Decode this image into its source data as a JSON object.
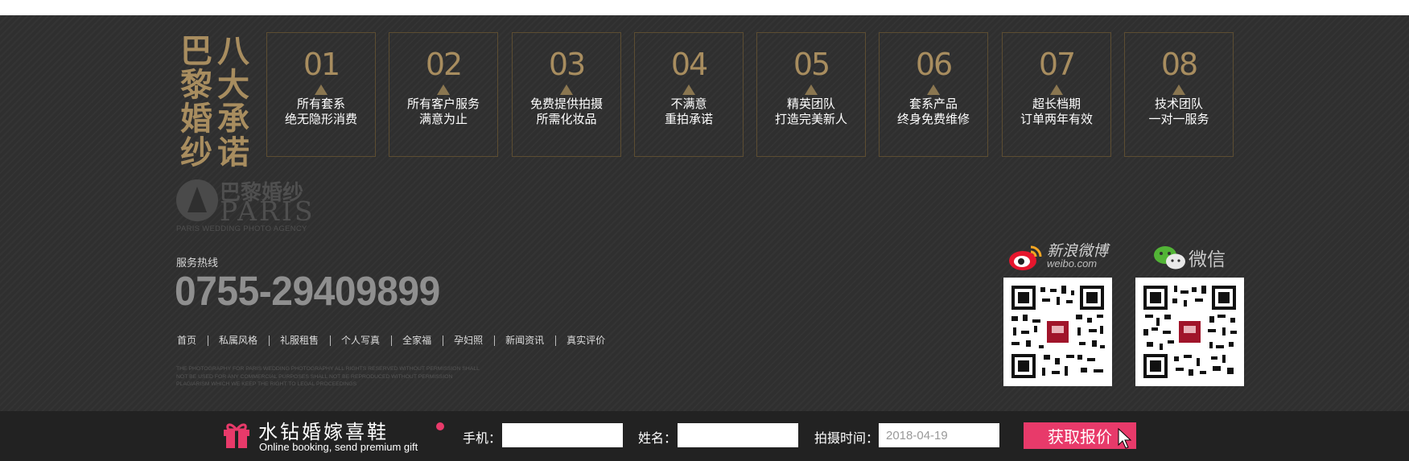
{
  "footer": {
    "title_col1": "巴黎婚纱",
    "title_col2": "八大承诺",
    "promises": [
      {
        "num": "01",
        "line1": "所有套系",
        "line2": "绝无隐形消费"
      },
      {
        "num": "02",
        "line1": "所有客户服务",
        "line2": "满意为止"
      },
      {
        "num": "03",
        "line1": "免费提供拍摄",
        "line2": "所需化妆品"
      },
      {
        "num": "04",
        "line1": "不满意",
        "line2": "重拍承诺"
      },
      {
        "num": "05",
        "line1": "精英团队",
        "line2": "打造完美新人"
      },
      {
        "num": "06",
        "line1": "套系产品",
        "line2": "终身免费维修"
      },
      {
        "num": "07",
        "line1": "超长档期",
        "line2": "订单两年有效"
      },
      {
        "num": "08",
        "line1": "技术团队",
        "line2": "一对一服务"
      }
    ],
    "logo": {
      "cn": "巴黎婚纱",
      "en": "PARIS",
      "sub": "PARIS WEDDING PHOTO AGENCY"
    },
    "hotline_label": "服务热线",
    "hotline": "0755-29409899",
    "nav": [
      "首页",
      "私属风格",
      "礼服租售",
      "个人写真",
      "全家福",
      "孕妇照",
      "新闻资讯",
      "真实评价"
    ],
    "copyright": [
      "THE PHOTOGRAPHY FOR PARIS WEDDING PHOTOGRAPHY ALL RIGHTS RESERVED WITHOUT PERMISSION SHALL",
      "NOT BE USED FOR ANY COMMERCIAL PURPOSES SHALL NOT BE REPRODUCED WITHOUT PERMISSION",
      "PLAGIARISM WHICH WE KEEP THE RIGHT TO LEGAL PROCEEDINGS"
    ],
    "weibo": {
      "name": "新浪微博",
      "domain": "weibo.com"
    },
    "wechat": {
      "name": "微信"
    }
  },
  "booking_bar": {
    "title": "水钻婚嫁喜鞋",
    "subtitle": "Online booking, send premium gift",
    "phone_label": "手机：",
    "phone_value": "",
    "name_label": "姓名：",
    "name_value": "",
    "date_label": "拍摄时间：",
    "date_value": "2018-04-19",
    "submit_label": "获取报价"
  },
  "colors": {
    "footer_bg": "#2f2f2f",
    "gold": "#a88d5f",
    "bar_bg": "#222222",
    "accent_pink": "#e83a6a"
  }
}
